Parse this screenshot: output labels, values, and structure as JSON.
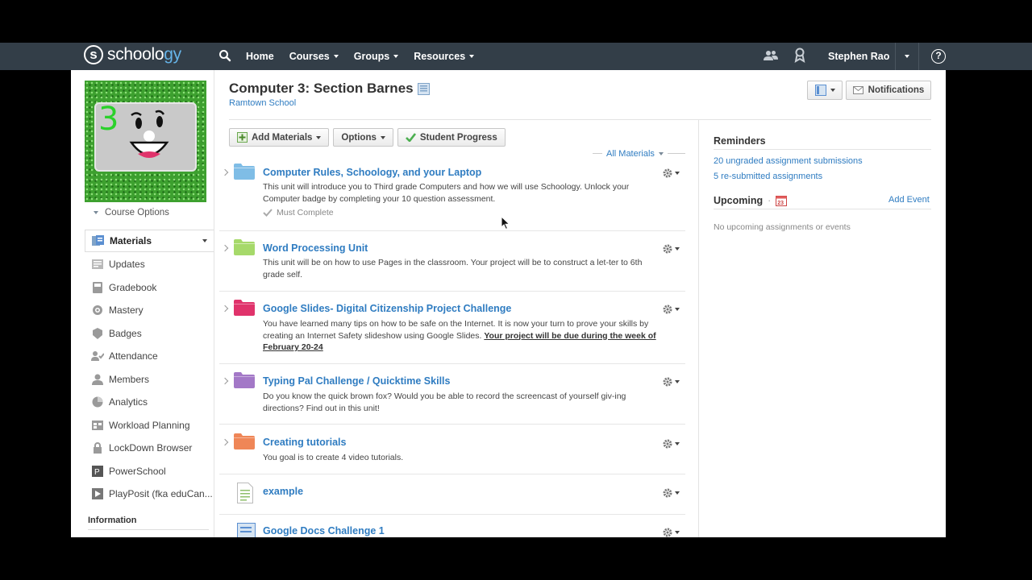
{
  "nav": {
    "logo_main": "schoolo",
    "logo_accent": "gy",
    "items": [
      "Home",
      "Courses",
      "Groups",
      "Resources"
    ],
    "user": "Stephen Rao",
    "help": "?"
  },
  "course": {
    "title": "Computer 3: Section Barnes",
    "school": "Ramtown School",
    "pic_label": "3",
    "options_label": "Course Options"
  },
  "sidebar": {
    "items": [
      {
        "label": "Materials",
        "icon": "materials-icon"
      },
      {
        "label": "Updates",
        "icon": "updates-icon"
      },
      {
        "label": "Gradebook",
        "icon": "gradebook-icon"
      },
      {
        "label": "Mastery",
        "icon": "mastery-icon"
      },
      {
        "label": "Badges",
        "icon": "badges-icon"
      },
      {
        "label": "Attendance",
        "icon": "attendance-icon"
      },
      {
        "label": "Members",
        "icon": "members-icon"
      },
      {
        "label": "Analytics",
        "icon": "analytics-icon"
      },
      {
        "label": "Workload Planning",
        "icon": "workload-icon"
      },
      {
        "label": "LockDown Browser",
        "icon": "lockdown-icon"
      },
      {
        "label": "PowerSchool",
        "icon": "powerschool-icon"
      },
      {
        "label": "PlayPosit (fka eduCan...",
        "icon": "playposit-icon"
      }
    ],
    "info_heading": "Information"
  },
  "header": {
    "notifications_label": "Notifications"
  },
  "toolbar": {
    "add_materials": "Add Materials",
    "options": "Options",
    "student_progress": "Student Progress",
    "all_materials": "All Materials"
  },
  "materials": [
    {
      "title": "Computer Rules, Schoology, and your Laptop",
      "desc": "This unit will introduce you to Third grade Computers and how we will use Schoology. Unlock your Computer badge by completing your 10 question assessment.",
      "desc_bold": "",
      "must": "Must Complete",
      "color": "#7fbde6",
      "type": "folder"
    },
    {
      "title": "Word Processing Unit",
      "desc": "This unit will be on how to use Pages in the classroom. Your project will be to construct a let-ter to 6th grade self.",
      "desc_bold": "",
      "must": "",
      "color": "#a6d96a",
      "type": "folder"
    },
    {
      "title": "Google Slides- Digital Citizenship Project Challenge",
      "desc": "You have learned many tips on how to be safe on the Internet. It is now your turn to prove your skills by creating an Internet Safety slideshow using Google Slides. ",
      "desc_bold": "Your project will be due during the week of February 20-24",
      "must": "",
      "color": "#e0336b",
      "type": "folder"
    },
    {
      "title": "Typing Pal Challenge / Quicktime Skills",
      "desc": "Do you know the quick brown fox? Would you be able to record the screencast of yourself giv-ing directions? Find out in this unit!",
      "desc_bold": "",
      "must": "",
      "color": "#a378c7",
      "type": "folder"
    },
    {
      "title": "Creating tutorials",
      "desc": "You goal is to create 4 video tutorials.",
      "desc_bold": "",
      "must": "",
      "color": "#ef8657",
      "type": "folder"
    },
    {
      "title": "example",
      "desc": "",
      "desc_bold": "",
      "must": "",
      "color": "#8fbf6b",
      "type": "page"
    },
    {
      "title": "Google Docs Challenge 1",
      "desc": "",
      "desc_bold": "",
      "must": "",
      "color": "#5b8fd1",
      "type": "assignment"
    }
  ],
  "reminders": {
    "title": "Reminders",
    "items": [
      "20 ungraded assignment submissions",
      "5 re-submitted assignments"
    ]
  },
  "upcoming": {
    "title": "Upcoming",
    "calendar_day": "23",
    "add_event": "Add Event",
    "empty": "No upcoming assignments or events"
  }
}
